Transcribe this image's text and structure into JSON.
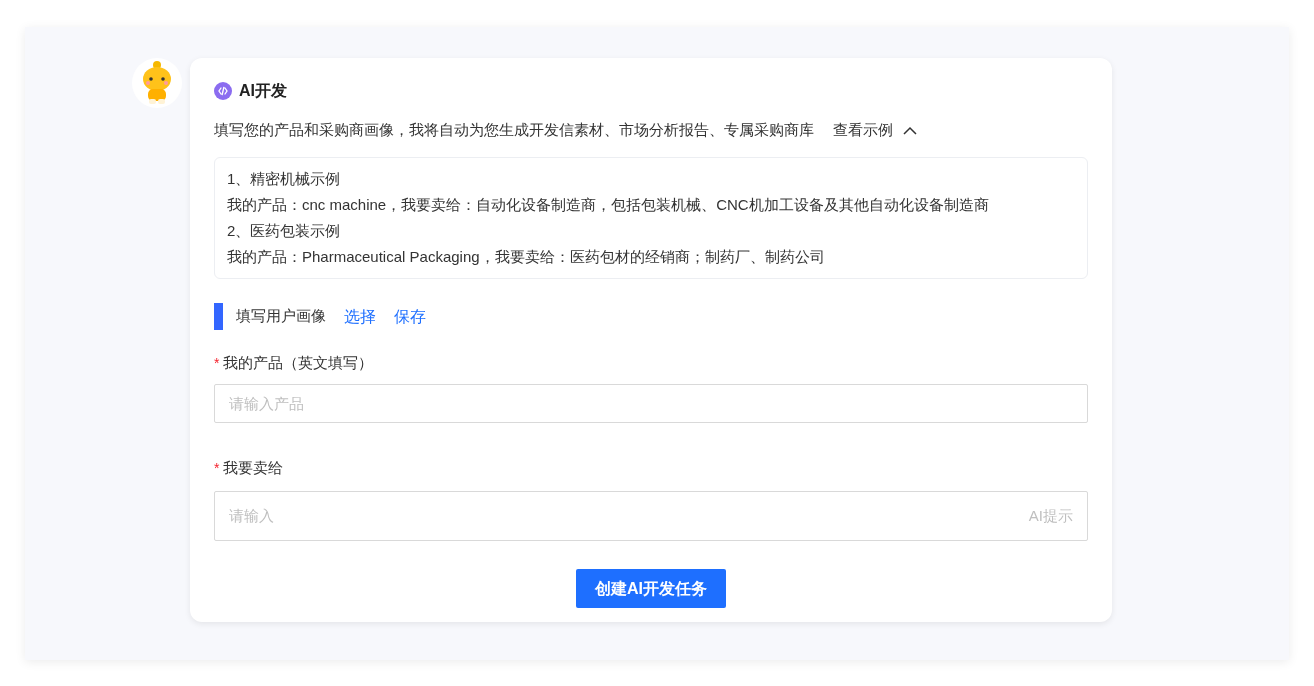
{
  "card": {
    "title": "AI开发",
    "description": "填写您的产品和采购商画像，我将自动为您生成开发信素材、市场分析报告、专属采购商库",
    "examples_toggle": {
      "label": "查看示例",
      "expanded": true
    },
    "examples": [
      "1、精密机械示例",
      "我的产品：cnc machine，我要卖给：自动化设备制造商，包括包装机械、CNC机加工设备及其他自动化设备制造商",
      "2、医药包装示例",
      "我的产品：Pharmaceutical Packaging，我要卖给：医药包材的经销商；制药厂、制药公司"
    ],
    "section": {
      "title": "填写用户画像",
      "links": [
        "选择",
        "保存"
      ]
    },
    "fields": [
      {
        "label": "我的产品（英文填写）",
        "required_mark": "*",
        "placeholder": "请输入产品",
        "kind": "input"
      },
      {
        "label": "我要卖给",
        "required_mark": "*",
        "placeholder": "请输入",
        "kind": "textarea",
        "hint": "AI提示"
      }
    ],
    "submit": "创建AI开发任务"
  }
}
